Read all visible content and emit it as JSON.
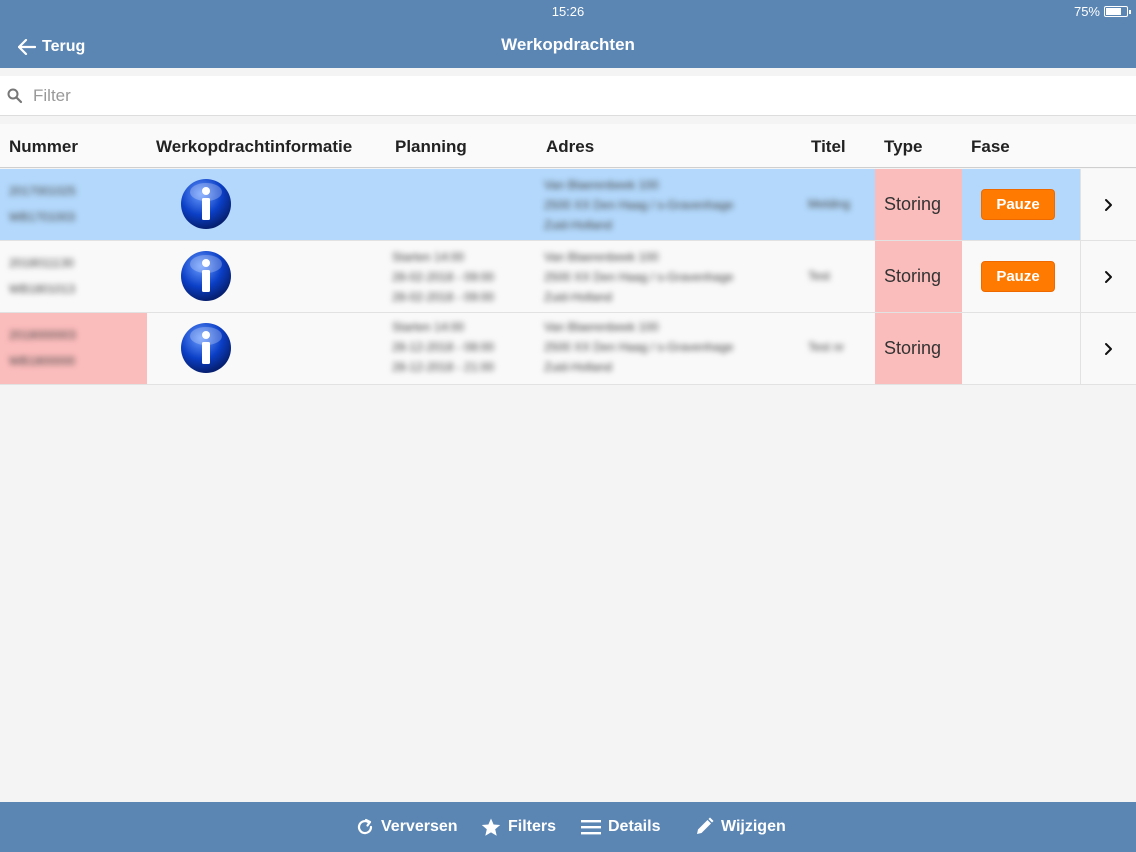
{
  "status": {
    "time": "15:26",
    "battery": "75%"
  },
  "header": {
    "back_label": "Terug",
    "title": "Werkopdrachten"
  },
  "filter": {
    "placeholder": "Filter",
    "value": ""
  },
  "table": {
    "columns": [
      "Nummer",
      "Werkopdrachtinformatie",
      "Planning",
      "Adres",
      "Titel",
      "Type",
      "Fase"
    ],
    "rows": [
      {
        "nummer": [
          "2017001025",
          "WB1701003"
        ],
        "planning": [],
        "adres": [
          "Van Blaerenbeek 100",
          "2500 XX Den Haag / s-Gravenhage",
          "Zuid-Holland"
        ],
        "titel": "Melding",
        "type": "Storing",
        "fase": "Pauze",
        "selected": true,
        "nummer_alert": false
      },
      {
        "nummer": [
          "2018011130",
          "WB1801013"
        ],
        "planning": [
          "Starten 14:00",
          "28-02-2018 - 09:00",
          "28-02-2018 - 09:00"
        ],
        "adres": [
          "Van Blaerenbeek 100",
          "2500 XX Den Haag / s-Gravenhage",
          "Zuid-Holland"
        ],
        "titel": "Test",
        "type": "Storing",
        "fase": "Pauze",
        "selected": false,
        "nummer_alert": false
      },
      {
        "nummer": [
          "2018000003",
          "WB1800000"
        ],
        "planning": [
          "Starten 14:00",
          "28-12-2018 - 08:00",
          "28-12-2018 - 21:00"
        ],
        "adres": [
          "Van Blaerenbeek 100",
          "2500 XX Den Haag / s-Gravenhage",
          "Zuid-Holland"
        ],
        "titel": "Test nr",
        "type": "Storing",
        "fase": "",
        "selected": false,
        "nummer_alert": true
      }
    ]
  },
  "footer": {
    "refresh_label": "Verversen",
    "filters_label": "Filters",
    "details_label": "Details",
    "edit_label": "Wijzigen"
  },
  "colors": {
    "header_bg": "#5b86b4",
    "selected_row": "#b3d8fb",
    "alert_cell": "#fbbcbc",
    "pauze_button": "#ff7a00"
  }
}
